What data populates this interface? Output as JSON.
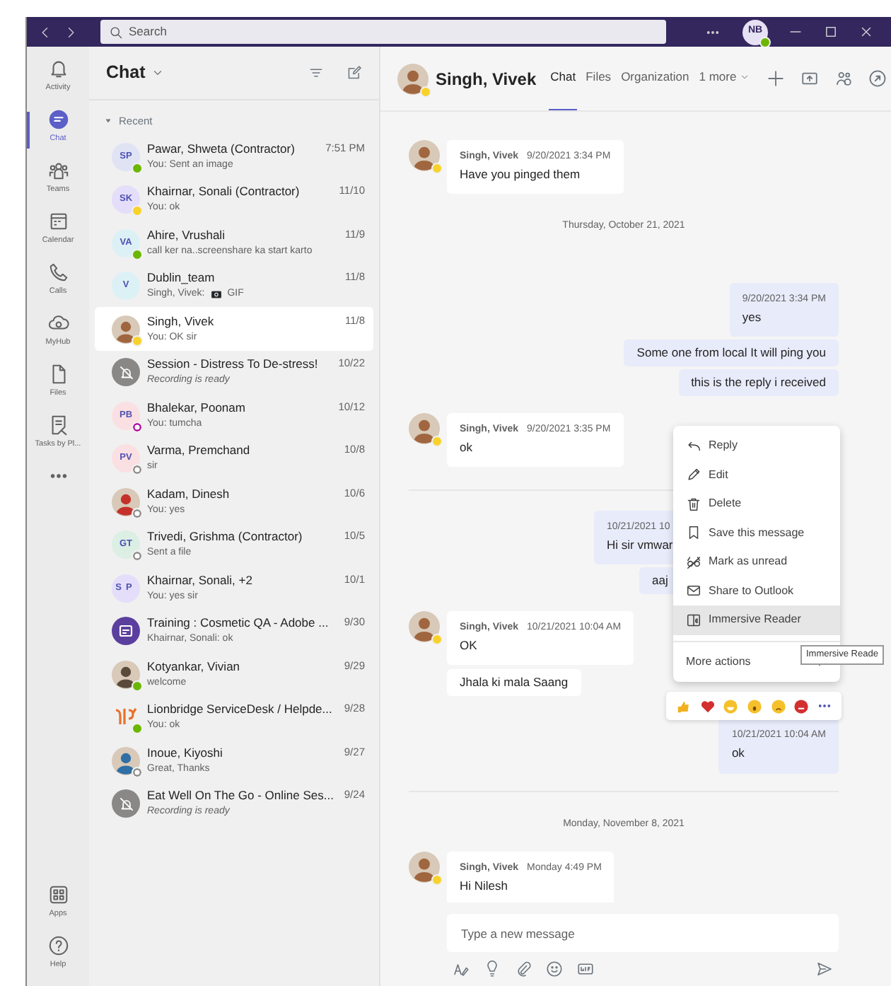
{
  "title_bar": {
    "search_placeholder": "Search",
    "user_initials": "NB",
    "user_presence": {
      "color": "#6bb700",
      "ring": false
    }
  },
  "rail": {
    "items": [
      {
        "kind": "activity",
        "label": "Activity",
        "selected": false
      },
      {
        "kind": "chat",
        "label": "Chat",
        "selected": true
      },
      {
        "kind": "teams",
        "label": "Teams",
        "selected": false
      },
      {
        "kind": "calendar",
        "label": "Calendar",
        "selected": false
      },
      {
        "kind": "calls",
        "label": "Calls",
        "selected": false
      },
      {
        "kind": "myhub",
        "label": "MyHub",
        "selected": false
      },
      {
        "kind": "files",
        "label": "Files",
        "selected": false
      },
      {
        "kind": "tasks",
        "label": "Tasks by Pl...",
        "selected": false
      },
      {
        "kind": "more",
        "selected": false
      }
    ],
    "bottom_items": [
      {
        "kind": "apps",
        "label": "Apps"
      },
      {
        "kind": "help",
        "label": "Help"
      }
    ]
  },
  "chat_list": {
    "title": "Chat",
    "section": "Recent",
    "items": [
      {
        "name": "Pawar, Shweta (Contractor)",
        "time": "7:51 PM",
        "preview": "You: Sent an image",
        "italic": false,
        "selected": false,
        "avatar": {
          "kind": "initials",
          "initials": "SP",
          "color": "#dfe3f4"
        },
        "presence": {
          "color": "#6bb700",
          "ring": false
        }
      },
      {
        "name": "Khairnar, Sonali (Contractor)",
        "time": "11/10",
        "preview": "You: ok",
        "italic": false,
        "selected": false,
        "avatar": {
          "kind": "initials",
          "initials": "SK",
          "color": "#e4defa"
        },
        "presence": {
          "color": "#f8d22a",
          "ring": false
        }
      },
      {
        "name": "Ahire, Vrushali",
        "time": "11/9",
        "preview": "call ker na..screenshare ka start karto",
        "italic": false,
        "selected": false,
        "avatar": {
          "kind": "initials",
          "initials": "VA",
          "color": "#dcf1f5"
        },
        "presence": {
          "color": "#6bb700",
          "ring": false
        }
      },
      {
        "name": "Dublin_team",
        "time": "11/8",
        "preview": "Singh, Vivek:",
        "attachment": "GIF",
        "italic": false,
        "selected": false,
        "avatar": {
          "kind": "group",
          "initials": "V",
          "color": "#dcf1f5"
        }
      },
      {
        "name": "Singh, Vivek",
        "time": "11/8",
        "preview": "You: OK sir",
        "italic": false,
        "selected": true,
        "avatar": {
          "kind": "photo",
          "color": "#a0663f"
        },
        "presence": {
          "color": "#f8d22a",
          "ring": false
        }
      },
      {
        "name": "Session - Distress To De-stress!",
        "time": "10/22",
        "preview": "Recording is ready",
        "italic": true,
        "selected": false,
        "avatar": {
          "kind": "recording",
          "color": "#8a8886"
        }
      },
      {
        "name": "Bhalekar, Poonam",
        "time": "10/12",
        "preview": "You: tumcha",
        "italic": false,
        "selected": false,
        "avatar": {
          "kind": "initials",
          "initials": "PB",
          "color": "#fbe0e3"
        },
        "presence": {
          "color": "#b4009e",
          "ring": true
        }
      },
      {
        "name": "Varma, Premchand",
        "time": "10/8",
        "preview": "sir",
        "italic": false,
        "selected": false,
        "avatar": {
          "kind": "initials",
          "initials": "PV",
          "color": "#fbe0e3"
        },
        "presence": {
          "color": "#8a8886",
          "ring": true
        }
      },
      {
        "name": "Kadam, Dinesh",
        "time": "10/6",
        "preview": "You: yes",
        "italic": false,
        "selected": false,
        "avatar": {
          "kind": "photo",
          "color": "#c4312b"
        },
        "presence": {
          "color": "#8a8886",
          "ring": true
        }
      },
      {
        "name": "Trivedi, Grishma (Contractor)",
        "time": "10/5",
        "preview": "Sent a file",
        "italic": false,
        "selected": false,
        "avatar": {
          "kind": "initials",
          "initials": "GT",
          "color": "#dcefe4"
        },
        "presence": {
          "color": "#8a8886",
          "ring": true
        }
      },
      {
        "name": "Khairnar, Sonali, +2",
        "time": "10/1",
        "preview": "You: yes sir",
        "italic": false,
        "selected": false,
        "avatar": {
          "kind": "pair",
          "initials": "SP",
          "color": "#e4defa"
        }
      },
      {
        "name": "Training : Cosmetic QA - Adobe ...",
        "time": "9/30",
        "preview": "Khairnar, Sonali: ok",
        "italic": false,
        "selected": false,
        "avatar": {
          "kind": "meeting",
          "color": "#5b3f9e"
        }
      },
      {
        "name": "Kotyankar, Vivian",
        "time": "9/29",
        "preview": "welcome",
        "italic": false,
        "selected": false,
        "avatar": {
          "kind": "photo",
          "color": "#5a4a3a"
        },
        "presence": {
          "color": "#6bb700",
          "ring": false
        }
      },
      {
        "name": "Lionbridge ServiceDesk / Helpde...",
        "time": "9/28",
        "preview": "You: ok",
        "italic": false,
        "selected": false,
        "avatar": {
          "kind": "logo",
          "color": "#e8702a"
        },
        "presence": {
          "color": "#6bb700",
          "ring": false
        }
      },
      {
        "name": "Inoue, Kiyoshi",
        "time": "9/27",
        "preview": "Great, Thanks",
        "italic": false,
        "selected": false,
        "avatar": {
          "kind": "photo",
          "color": "#2f6fa5"
        },
        "presence": {
          "color": "#8a8886",
          "ring": true
        }
      },
      {
        "name": "Eat Well On The Go - Online Ses...",
        "time": "9/24",
        "preview": "Recording is ready",
        "italic": true,
        "selected": false,
        "avatar": {
          "kind": "recording",
          "color": "#8a8886"
        }
      }
    ]
  },
  "conversation": {
    "name": "Singh, Vivek",
    "tabs": [
      {
        "label": "Chat",
        "selected": true,
        "dropdown": false
      },
      {
        "label": "Files",
        "selected": false,
        "dropdown": false
      },
      {
        "label": "Organization",
        "selected": false,
        "dropdown": false
      },
      {
        "label": "1 more",
        "selected": false,
        "dropdown": true
      }
    ],
    "messages": [
      {
        "kind": "incoming",
        "author": "Singh, Vivek",
        "time": "9/20/2021 3:34 PM",
        "texts": [
          "Have you pinged them"
        ]
      },
      {
        "kind": "date",
        "text": "Thursday, October 21, 2021"
      },
      {
        "kind": "outgoing",
        "time": "9/20/2021 3:34 PM",
        "texts": [
          "yes",
          "Some one from local It will ping you",
          "this is the reply i received"
        ]
      },
      {
        "kind": "incoming",
        "author": "Singh, Vivek",
        "time": "9/20/2021 3:35 PM",
        "texts": [
          "ok"
        ]
      },
      {
        "kind": "rule"
      },
      {
        "kind": "outgoing",
        "time": "10/21/2021 10",
        "texts": [
          "Hi sir vmwar",
          "aaj"
        ]
      },
      {
        "kind": "incoming",
        "author": "Singh, Vivek",
        "time": "10/21/2021 10:04 AM",
        "texts": [
          "OK",
          "Jhala ki mala Saang"
        ]
      },
      {
        "kind": "outgoing",
        "time": "10/21/2021 10:04 AM",
        "texts": [
          "ok"
        ]
      },
      {
        "kind": "rule"
      },
      {
        "kind": "date",
        "text": "Monday, November 8, 2021"
      },
      {
        "kind": "incoming",
        "author": "Singh, Vivek",
        "time": "Monday 4:49 PM",
        "texts": [
          "Hi Nilesh"
        ]
      }
    ],
    "context_menu": {
      "items": [
        {
          "kind": "reply",
          "label": "Reply",
          "selected": false
        },
        {
          "kind": "edit",
          "label": "Edit",
          "selected": false
        },
        {
          "kind": "delete",
          "label": "Delete",
          "selected": false
        },
        {
          "kind": "save",
          "label": "Save this message",
          "selected": false
        },
        {
          "kind": "unread",
          "label": "Mark as unread",
          "selected": false
        },
        {
          "kind": "outlook",
          "label": "Share to Outlook",
          "selected": false
        },
        {
          "kind": "reader",
          "label": "Immersive Reader",
          "selected": true
        }
      ],
      "more_label": "More actions",
      "tooltip": "Immersive Reade"
    },
    "reactions": [
      {
        "kind": "like"
      },
      {
        "kind": "heart"
      },
      {
        "kind": "laugh"
      },
      {
        "kind": "surprised"
      },
      {
        "kind": "sad"
      },
      {
        "kind": "angry"
      },
      {
        "kind": "more"
      }
    ],
    "compose": {
      "placeholder": "Type a new message"
    }
  }
}
